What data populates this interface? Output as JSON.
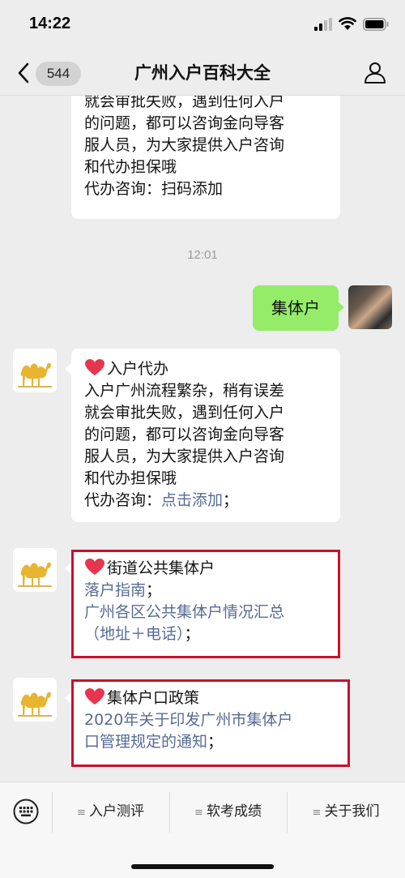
{
  "status": {
    "time": "14:22"
  },
  "nav": {
    "badge": "544",
    "title": "广州入户百科大全"
  },
  "messages": {
    "first": {
      "lines": [
        "就会审批失败，遇到任何入户",
        "的问题，都可以咨询金向导客",
        "服人员，为大家提供入户咨询",
        "和代办担保哦",
        "代办咨询：扫码添加"
      ]
    },
    "timestamp": "12:01",
    "user": {
      "text": "集体户"
    },
    "second": {
      "title": "入户代办",
      "lines": [
        "入户广州流程繁杂，稍有误差",
        "就会审批失败，遇到任何入户",
        "的问题，都可以咨询金向导客",
        "服人员，为大家提供入户咨询",
        "和代办担保哦"
      ],
      "contact_prefix": "代办咨询：",
      "contact_link": "点击添加",
      "contact_suffix": "；"
    },
    "third": {
      "title": "街道公共集体户",
      "link1": "落户指南",
      "link1_suffix": "；",
      "link2_line1": "广州各区公共集体户情况汇总",
      "link2_line2": "（地址＋电话）",
      "link2_suffix": "；"
    },
    "fourth": {
      "title": "集体户口政策",
      "link_line1": "2020年关于印发广州市集体户",
      "link_line2": "口管理规定的通知",
      "link_suffix": "；"
    }
  },
  "menu": {
    "items": [
      "入户测评",
      "软考成绩",
      "关于我们"
    ]
  },
  "colors": {
    "accent_link": "#576b95",
    "green_bubble": "#95ec69",
    "highlight_frame": "#c8102e",
    "heart": "#e8344e"
  }
}
